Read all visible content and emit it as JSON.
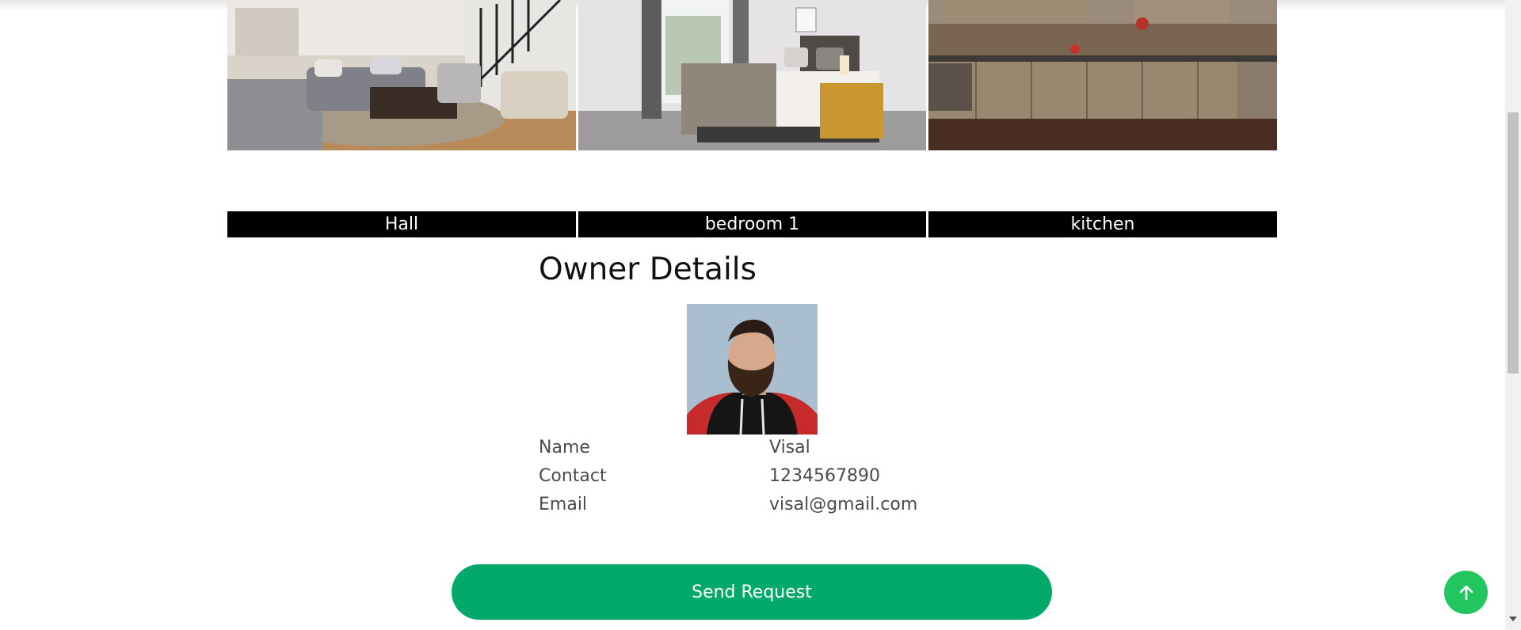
{
  "gallery": {
    "items": [
      {
        "caption": "Hall",
        "icon": "hall-photo"
      },
      {
        "caption": "bedroom 1",
        "icon": "bedroom-photo"
      },
      {
        "caption": "kitchen",
        "icon": "kitchen-photo"
      }
    ]
  },
  "owner": {
    "title": "Owner Details",
    "avatar_icon": "owner-avatar-photo",
    "fields": [
      {
        "label": "Name",
        "value": "Visal"
      },
      {
        "label": "Contact",
        "value": "1234567890"
      },
      {
        "label": "Email",
        "value": "visal@gmail.com"
      }
    ]
  },
  "actions": {
    "send_request_label": "Send Request",
    "scroll_top_icon": "arrow-up-icon"
  },
  "colors": {
    "accent": "#03a96b",
    "scroll_top": "#22c55e",
    "caption_bg": "#000000"
  }
}
